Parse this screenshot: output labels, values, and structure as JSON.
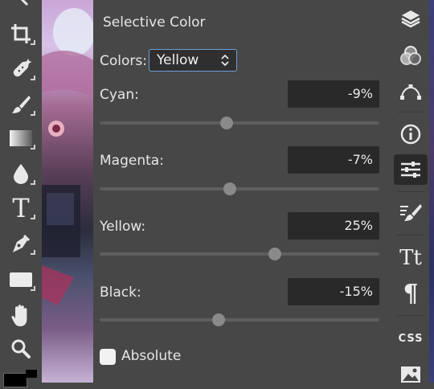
{
  "panel": {
    "title": "Selective Color",
    "colors_label": "Colors:",
    "colors_value": "Yellow",
    "sliders": [
      {
        "label": "Cyan:",
        "value_text": "-9%",
        "value": -9
      },
      {
        "label": "Magenta:",
        "value_text": "-7%",
        "value": -7
      },
      {
        "label": "Yellow:",
        "value_text": "25%",
        "value": 25
      },
      {
        "label": "Black:",
        "value_text": "-15%",
        "value": -15
      }
    ],
    "slider_range": [
      -100,
      100
    ],
    "absolute_label": "Absolute",
    "absolute_checked": false
  },
  "left_tools": [
    "crop-icon",
    "healing-brush-icon",
    "brush-icon",
    "gradient-icon",
    "blur-drop-icon",
    "text-tool-icon",
    "pen-tool-icon",
    "rectangle-icon",
    "hand-icon",
    "zoom-icon"
  ],
  "right_tools": [
    "layers-icon",
    "channels-icon",
    "paths-icon",
    "info-icon",
    "adjustments-icon",
    "brush-settings-icon",
    "character-icon",
    "paragraph-icon",
    "css-icon",
    "image-icon"
  ],
  "right_labels": {
    "css": "CSS",
    "paragraph": "¶",
    "character": "Tt",
    "text_tool": "T"
  },
  "colors": {
    "panel_bg": "#474747",
    "input_bg": "#292929",
    "select_border": "#6f9fd9",
    "active_tool_bg": "#2a2a2a"
  }
}
